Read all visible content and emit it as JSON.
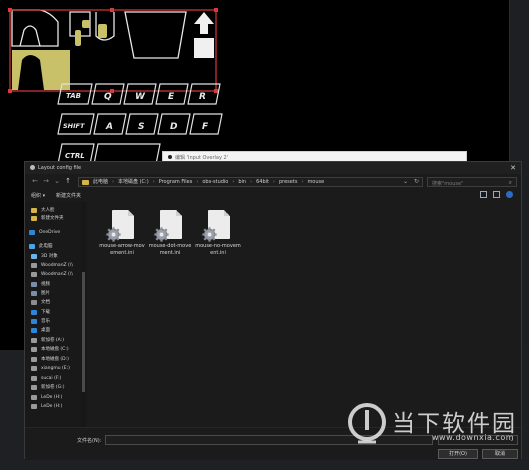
{
  "background": {
    "keys": {
      "row1": [
        "TAB",
        "Q",
        "W",
        "E",
        "R"
      ],
      "row2": [
        "SHIFT",
        "A",
        "S",
        "D",
        "F"
      ],
      "row3": [
        "CTRL"
      ]
    },
    "bg_window_title": "编辑 'Input Overlay 2'"
  },
  "dialog": {
    "title": "Layout config file",
    "close": "✕",
    "nav": {
      "back": "←",
      "forward": "→",
      "up": "↑",
      "recent": "⌄"
    },
    "address": {
      "crumbs": [
        "此电脑",
        "本地磁盘 (C:)",
        "Program Files",
        "obs-studio",
        "bin",
        "64bit",
        "presets",
        "mouse"
      ]
    },
    "search": {
      "placeholder": "搜索\"mouse\""
    },
    "toolbar": {
      "organize": "组织 ▾",
      "new_folder": "新建文件夹"
    },
    "sidebar": {
      "items": [
        {
          "label": "大人脸",
          "icon": "folder-icon",
          "color": "#d7b44a"
        },
        {
          "label": "新建文件夹",
          "icon": "folder-icon",
          "color": "#d7b44a"
        },
        {
          "label": "OneDrive",
          "icon": "onedrive-icon",
          "color": "#2f86d6"
        },
        {
          "label": "此电脑",
          "icon": "pc-icon",
          "color": "#4aa3e3"
        },
        {
          "label": "3D 对象",
          "icon": "3d-objects-icon",
          "color": "#6fb2e8"
        },
        {
          "label": "WoodmanZ (\\\\",
          "icon": "network-drive-icon",
          "color": "#9a9a9a"
        },
        {
          "label": "WoodmanZ (\\\\",
          "icon": "network-drive-icon",
          "color": "#9a9a9a"
        },
        {
          "label": "视频",
          "icon": "video-icon",
          "color": "#7a8fa6"
        },
        {
          "label": "图片",
          "icon": "pictures-icon",
          "color": "#7a8fa6"
        },
        {
          "label": "文档",
          "icon": "documents-icon",
          "color": "#8c8c8c"
        },
        {
          "label": "下载",
          "icon": "download-icon",
          "color": "#2f86d6"
        },
        {
          "label": "音乐",
          "icon": "music-icon",
          "color": "#2f86d6"
        },
        {
          "label": "桌面",
          "icon": "desktop-icon",
          "color": "#2f86d6"
        },
        {
          "label": "新加卷 (A:)",
          "icon": "drive-icon",
          "color": "#9a9a9a"
        },
        {
          "label": "本地磁盘 (C:)",
          "icon": "drive-icon",
          "color": "#9a9a9a"
        },
        {
          "label": "本地磁盘 (D:)",
          "icon": "drive-icon",
          "color": "#9a9a9a"
        },
        {
          "label": "xiangmu (E:)",
          "icon": "drive-icon",
          "color": "#9a9a9a"
        },
        {
          "label": "sucai (F:)",
          "icon": "drive-icon",
          "color": "#9a9a9a"
        },
        {
          "label": "新加卷 (G:)",
          "icon": "drive-icon",
          "color": "#9a9a9a"
        },
        {
          "label": "LeDe (H:)",
          "icon": "drive-icon",
          "color": "#9a9a9a"
        },
        {
          "label": "LeDe (H:)",
          "icon": "drive-icon",
          "color": "#9a9a9a"
        }
      ]
    },
    "files": [
      {
        "name": "mouse-arrow-movement.ini"
      },
      {
        "name": "mouse-dot-movement.ini"
      },
      {
        "name": "mouse-no-movement.ini"
      }
    ],
    "bottom": {
      "filename_label": "文件名(N):",
      "filename_value": "",
      "filetype_value": "",
      "open_label": "打开(O)",
      "cancel_label": "取消"
    }
  },
  "watermark": {
    "text": "当下软件园",
    "url": "www.downxia.com"
  }
}
